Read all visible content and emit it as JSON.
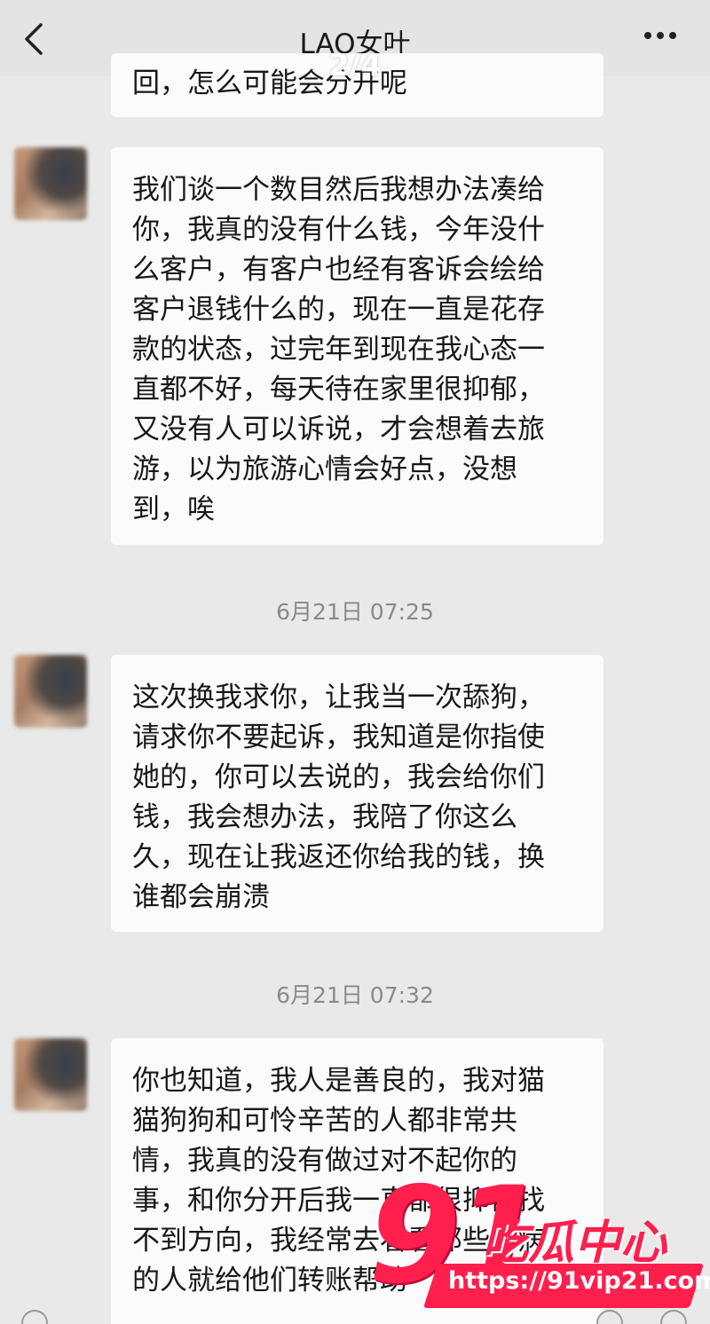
{
  "header": {
    "title": "LAO女叶",
    "page_indicator": "2/4"
  },
  "messages": [
    {
      "lines": [
        "回，怎么可能会分开呢"
      ]
    },
    {
      "lines": [
        "我们谈一个数目然后我想办法凑给",
        "你，我真的没有什么钱，今年没什",
        "么客户，有客户也经有客诉会绘给",
        "客户退钱什么的，现在一直是花存",
        "款的状态，过完年到现在我心态一",
        "直都不好，每天待在家里很抑郁，",
        "又没有人可以诉说，才会想着去旅",
        "游，以为旅游心情会好点，没想",
        "到，唉"
      ]
    },
    {
      "timestamp": "6月21日 07:25",
      "lines": [
        "这次换我求你，让我当一次舔狗，",
        "请求你不要起诉，我知道是你指使",
        "她的，你可以去说的，我会给你们",
        "钱，我会想办法，我陪了你这么",
        "久，现在让我返还你给我的钱，换",
        "谁都会崩溃"
      ]
    },
    {
      "timestamp": "6月21日 07:32",
      "lines": [
        "你也知道，我人是善良的，我对猫",
        "猫狗狗和可怜辛苦的人都非常共",
        "情，我真的没有做过对不起你的",
        "事，和你分开后我一直都很抑郁找",
        "不到方向，我经常去看看那些生病",
        "的人就给他们转账帮助"
      ]
    }
  ],
  "watermark": {
    "number": "91",
    "brand": "吃瓜中心",
    "url": "https://91vip21.com"
  },
  "icons": {
    "back": "chevron-left-icon",
    "more": "more-dots-icon"
  },
  "colors": {
    "background": "#e9e9e9",
    "bubble": "#fbfbfb",
    "watermark": "#ff1f4d"
  }
}
